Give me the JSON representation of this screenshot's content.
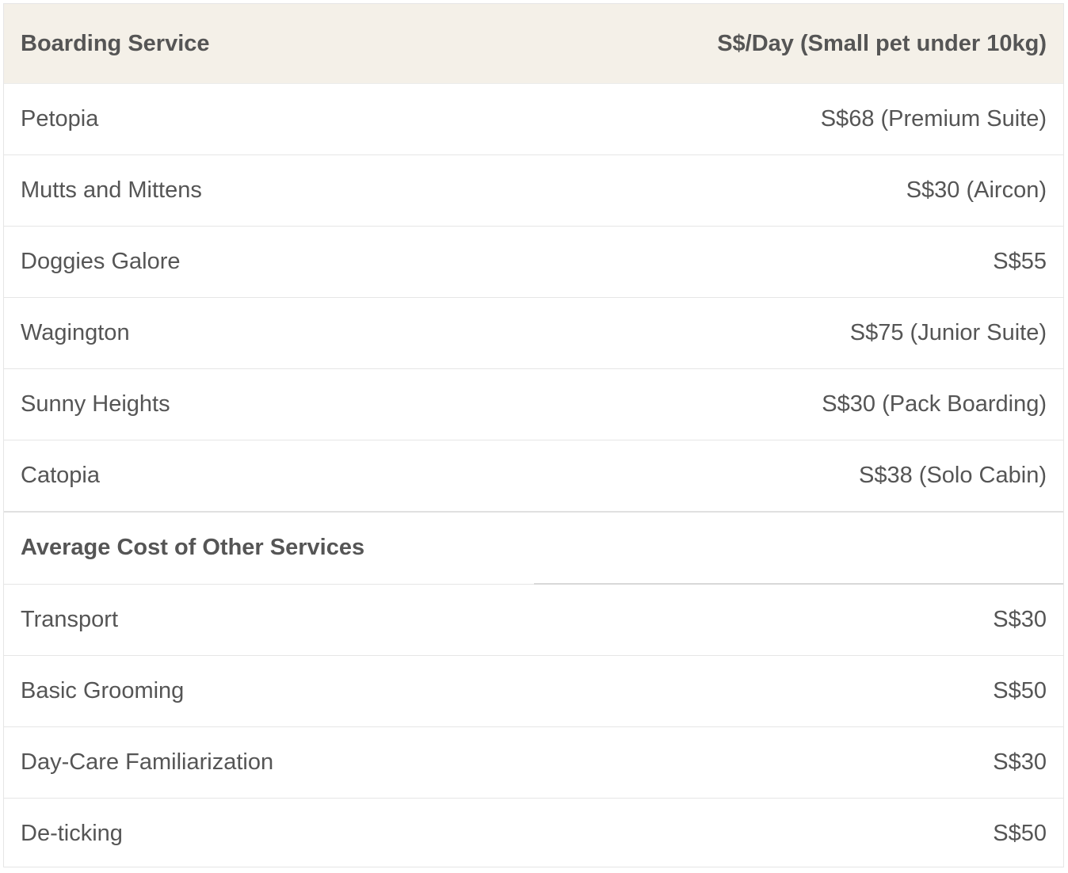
{
  "table": {
    "header": {
      "service": "Boarding Service",
      "price": "S$/Day (Small pet under 10kg)"
    },
    "boarding_rows": [
      {
        "name": "Petopia",
        "price": "S$68 (Premium Suite)"
      },
      {
        "name": "Mutts and Mittens",
        "price": "S$30 (Aircon)"
      },
      {
        "name": "Doggies Galore",
        "price": "S$55"
      },
      {
        "name": "Wagington",
        "price": "S$75 (Junior Suite)"
      },
      {
        "name": "Sunny Heights",
        "price": "S$30 (Pack Boarding)"
      },
      {
        "name": "Catopia",
        "price": "S$38 (Solo Cabin)"
      }
    ],
    "section_heading": "Average Cost of Other Services",
    "other_rows": [
      {
        "name": "Transport",
        "price": "S$30"
      },
      {
        "name": "Basic Grooming",
        "price": "S$50"
      },
      {
        "name": "Day-Care Familiarization",
        "price": "S$30"
      },
      {
        "name": "De-ticking",
        "price": "S$50"
      }
    ]
  },
  "colors": {
    "header_background": "#f4f0e8",
    "text": "#555555",
    "border": "#e6e6e6"
  }
}
